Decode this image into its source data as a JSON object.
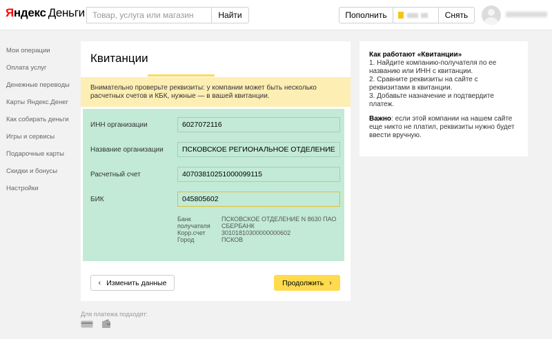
{
  "header": {
    "logo_brand": "Яндекс",
    "logo_product": "Деньги",
    "search_placeholder": "Товар, услуга или магазин",
    "search_button": "Найти",
    "topup_button": "Пополнить",
    "withdraw_button": "Снять"
  },
  "sidebar": {
    "items": [
      {
        "label": "Мои операции"
      },
      {
        "label": "Оплата услуг"
      },
      {
        "label": "Денежные переводы"
      },
      {
        "label": "Карты Яндекс.Денег"
      },
      {
        "label": "Как собирать деньги"
      },
      {
        "label": "Игры и сервисы"
      },
      {
        "label": "Подарочные карты"
      },
      {
        "label": "Скидки и бонусы"
      },
      {
        "label": "Настройки"
      }
    ]
  },
  "main": {
    "title": "Квитанции",
    "warning": "Внимательно проверьте реквизиты: у компании может быть несколько расчетных счетов и КБК, нужные — в вашей квитанции.",
    "fields": [
      {
        "label": "ИНН организации",
        "value": "6027072116"
      },
      {
        "label": "Название организации",
        "value": "ПСКОВСКОЕ РЕГИОНАЛЬНОЕ ОТДЕЛЕНИЕ Р"
      },
      {
        "label": "Расчетный счет",
        "value": "40703810251000099115"
      },
      {
        "label": "БИК",
        "value": "045805602"
      }
    ],
    "bank": {
      "bank_key": "Банк",
      "bank_key2": "получателя",
      "bank_val": "ПСКОВСКОЕ ОТДЕЛЕНИЕ N 8630 ПАО",
      "bank_val2": "СБЕРБАНК",
      "corr_key": "Корр.счет",
      "corr_val": "30101810300000000602",
      "city_key": "Город",
      "city_val": "ПСКОВ"
    },
    "change_button": "Изменить данные",
    "continue_button": "Продолжить",
    "footer_note": "Для платежа подходят:"
  },
  "help": {
    "title": "Как работают «Квитанции»",
    "steps": [
      "1. Найдите компанию-получателя по ее названию или ИНН с квитанции.",
      "2. Сравните реквизиты на сайте с реквизитами в квитанции.",
      "3. Добавьте назначение и подтвердите платеж."
    ],
    "important_label": "Важно",
    "important_text": ": если этой компании на нашем сайте еще никто не платил, реквизиты нужно будет ввести вручную."
  },
  "colors": {
    "accent_yellow": "#ffdb4d",
    "warning_bg": "#fdeeb4",
    "green_bg": "#c2ead7",
    "logo_red": "#ff0000"
  }
}
